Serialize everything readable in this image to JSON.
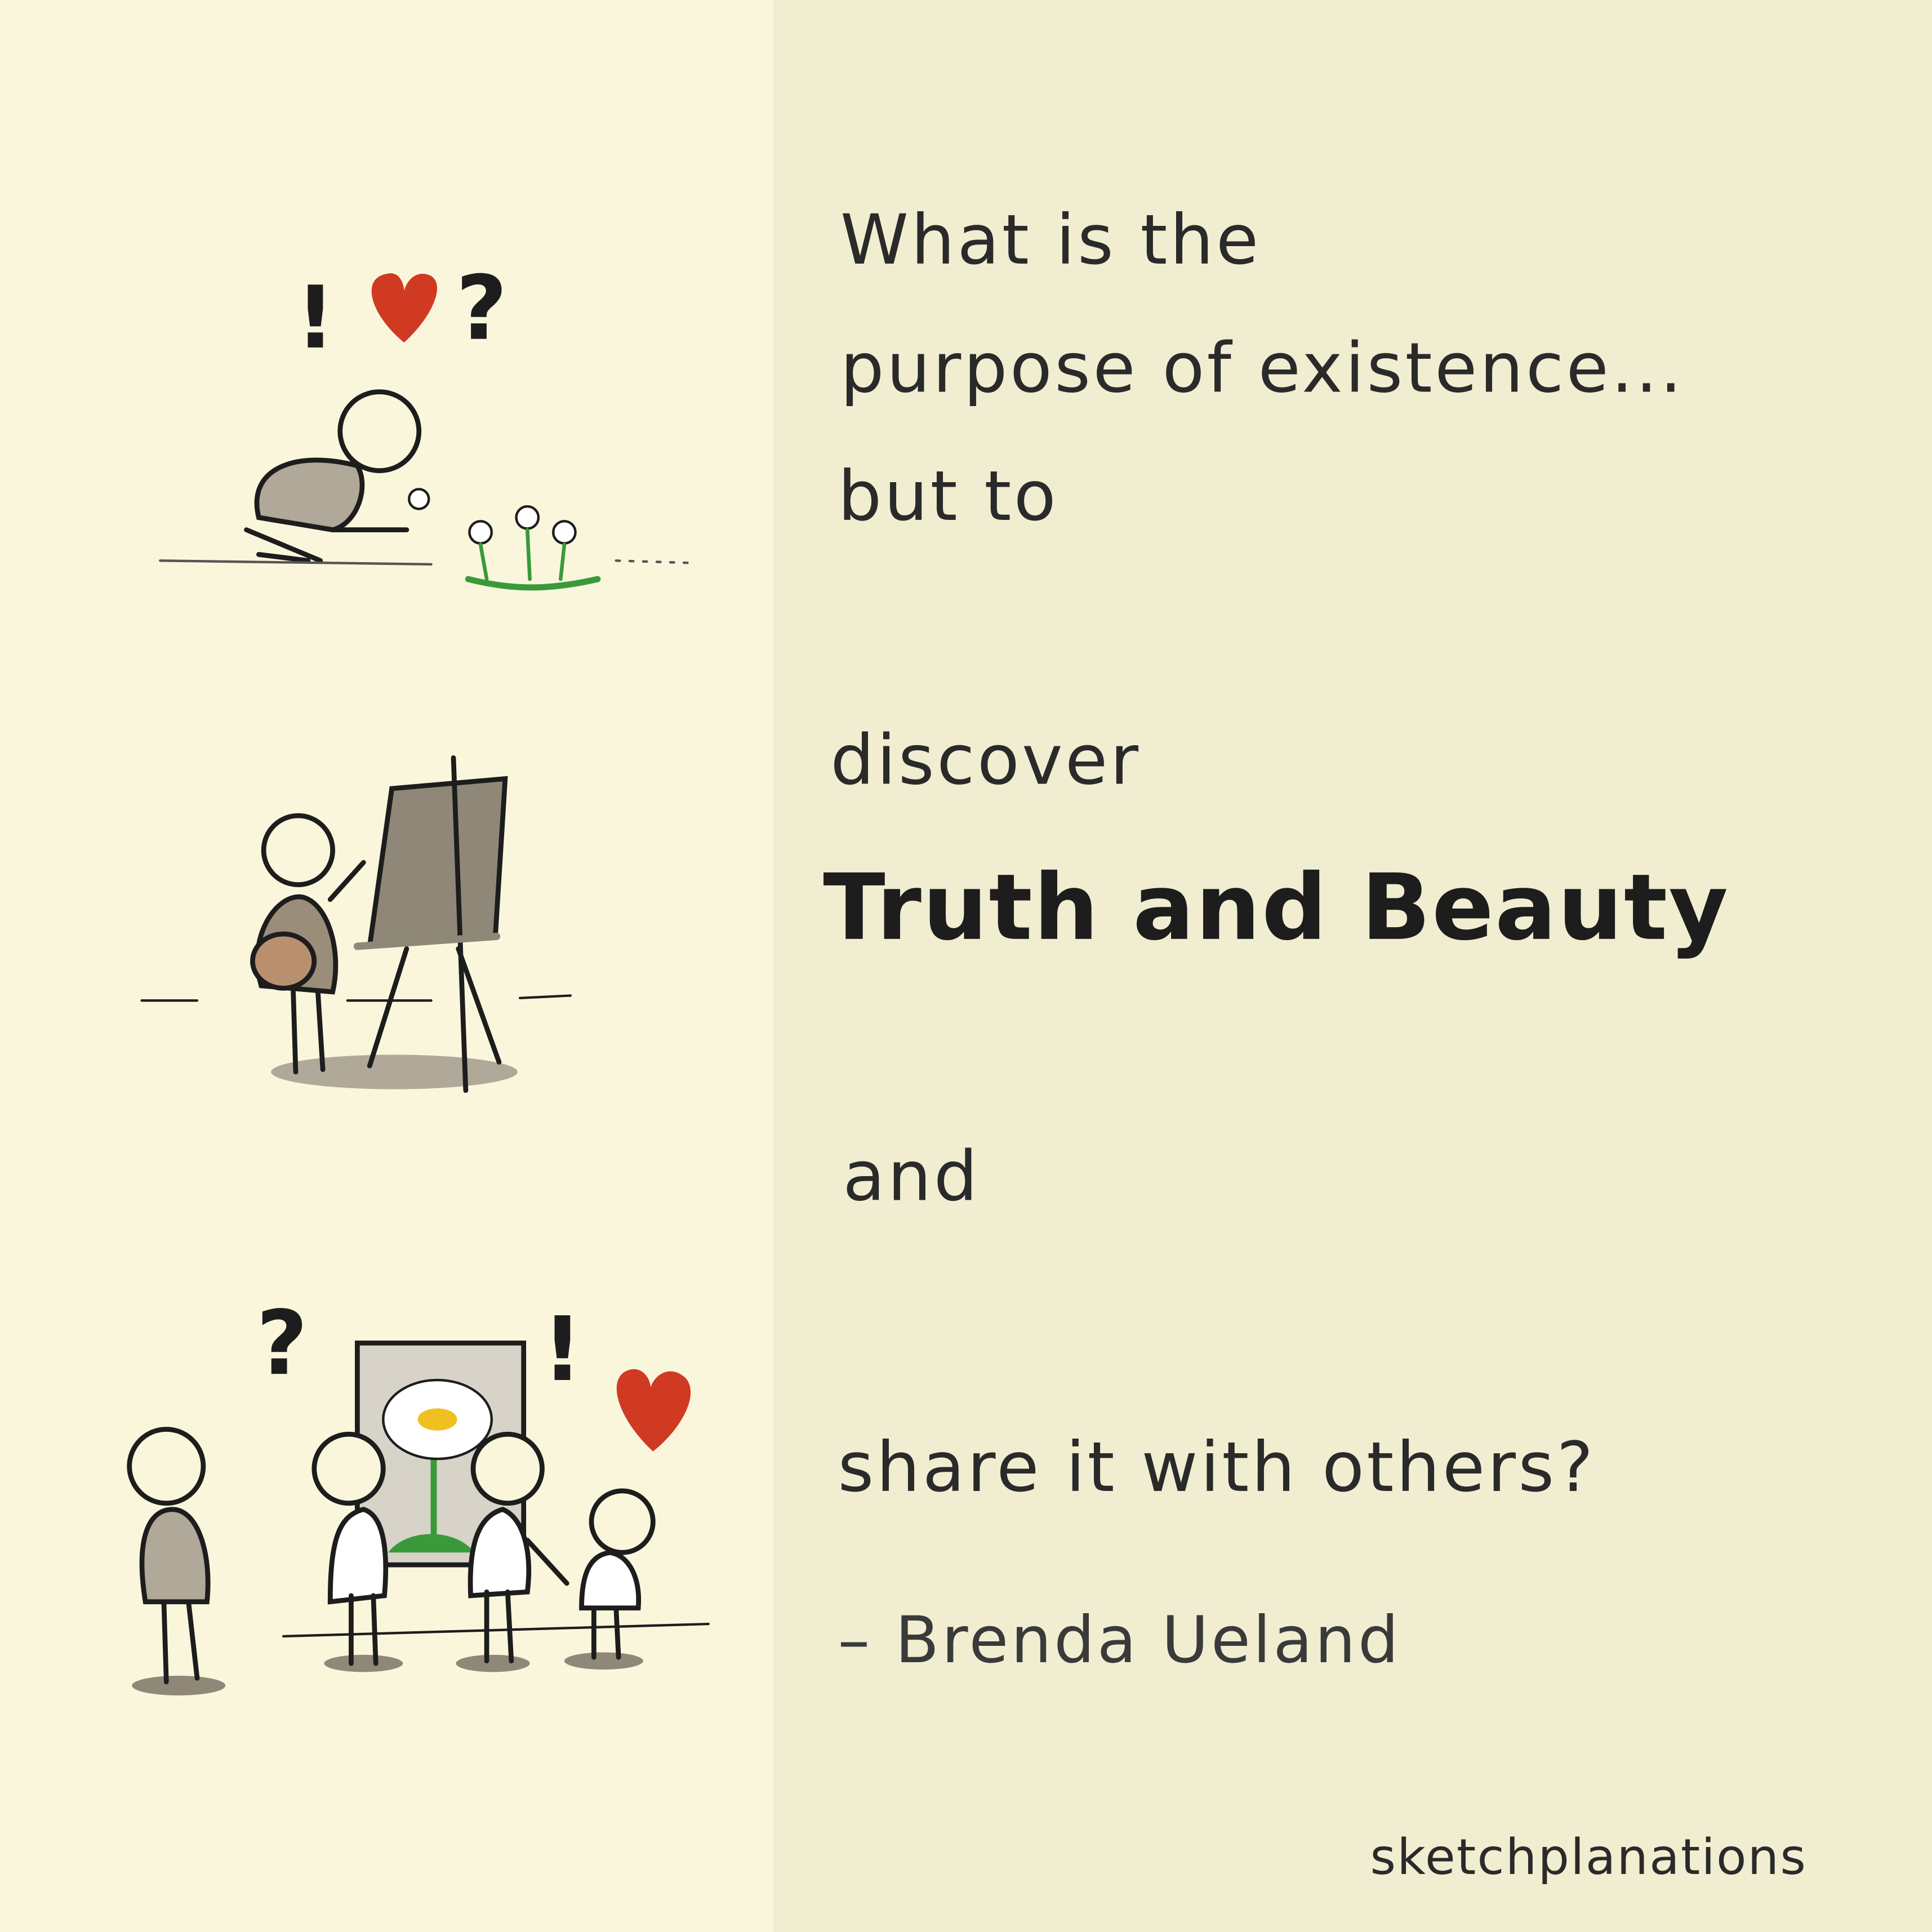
{
  "quote": {
    "line1": "What is the",
    "line2": "purpose of existence...",
    "line3": "but to",
    "line4": "discover",
    "emphasis": "Truth and Beauty",
    "line5": "and",
    "line6": "share it with others?",
    "attribution": "– Brenda Ueland"
  },
  "brand": "sketchplanations",
  "colors": {
    "left_bg": "#faf6dc",
    "right_bg": "#f1edd1",
    "heart": "#d13a22",
    "ink": "#2a2a2a",
    "grey": "#b0a898",
    "green": "#3a9a3a"
  },
  "symbols": {
    "exclaim": "!",
    "question": "?"
  }
}
